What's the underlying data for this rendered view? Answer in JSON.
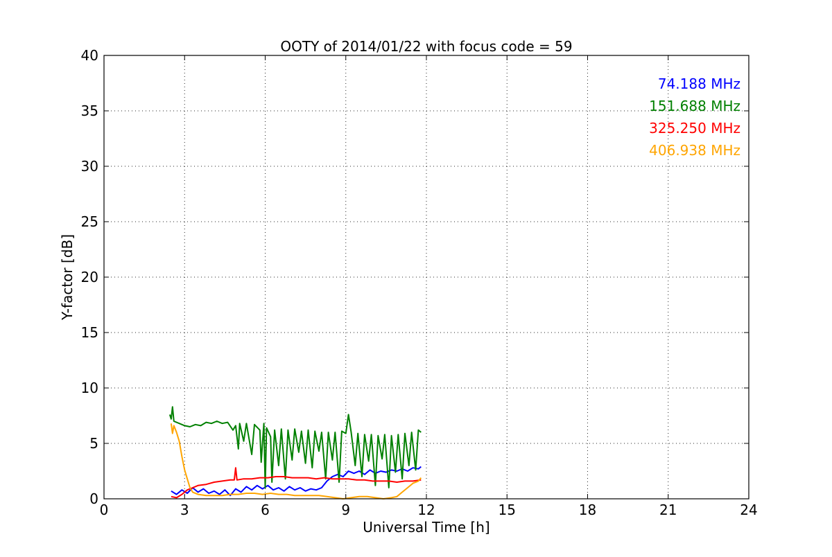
{
  "chart_data": {
    "type": "line",
    "title": "OOTY of 2014/01/22 with focus code = 59",
    "xlabel": "Universal Time [h]",
    "ylabel": "Y-factor [dB]",
    "xlim": [
      0,
      24
    ],
    "ylim": [
      0,
      40
    ],
    "xticks": [
      0,
      3,
      6,
      9,
      12,
      15,
      18,
      21,
      24
    ],
    "yticks": [
      0,
      5,
      10,
      15,
      20,
      25,
      30,
      35,
      40
    ],
    "grid": true,
    "legend_placement": "top-right",
    "series": [
      {
        "name": "74.188 MHz",
        "color": "#0000ff",
        "points": [
          [
            2.5,
            0.7
          ],
          [
            2.7,
            0.4
          ],
          [
            2.9,
            0.8
          ],
          [
            3.1,
            0.5
          ],
          [
            3.3,
            1.0
          ],
          [
            3.5,
            0.6
          ],
          [
            3.7,
            0.9
          ],
          [
            3.9,
            0.5
          ],
          [
            4.1,
            0.7
          ],
          [
            4.3,
            0.4
          ],
          [
            4.5,
            0.8
          ],
          [
            4.7,
            0.3
          ],
          [
            4.9,
            0.9
          ],
          [
            5.1,
            0.6
          ],
          [
            5.3,
            1.1
          ],
          [
            5.5,
            0.8
          ],
          [
            5.7,
            1.2
          ],
          [
            5.9,
            0.9
          ],
          [
            6.1,
            1.2
          ],
          [
            6.3,
            0.8
          ],
          [
            6.5,
            1.0
          ],
          [
            6.7,
            0.7
          ],
          [
            6.9,
            1.1
          ],
          [
            7.1,
            0.8
          ],
          [
            7.3,
            1.0
          ],
          [
            7.5,
            0.7
          ],
          [
            7.7,
            0.9
          ],
          [
            7.9,
            0.8
          ],
          [
            8.1,
            1.0
          ],
          [
            8.3,
            1.6
          ],
          [
            8.5,
            2.0
          ],
          [
            8.7,
            2.2
          ],
          [
            8.9,
            2.0
          ],
          [
            9.1,
            2.5
          ],
          [
            9.3,
            2.3
          ],
          [
            9.5,
            2.5
          ],
          [
            9.7,
            2.2
          ],
          [
            9.9,
            2.6
          ],
          [
            10.1,
            2.3
          ],
          [
            10.3,
            2.5
          ],
          [
            10.5,
            2.4
          ],
          [
            10.7,
            2.6
          ],
          [
            10.9,
            2.5
          ],
          [
            11.1,
            2.7
          ],
          [
            11.3,
            2.5
          ],
          [
            11.5,
            2.8
          ],
          [
            11.7,
            2.7
          ],
          [
            11.8,
            2.9
          ]
        ]
      },
      {
        "name": "151.688 MHz",
        "color": "#008000",
        "points": [
          [
            2.45,
            7.6
          ],
          [
            2.5,
            7.2
          ],
          [
            2.55,
            8.3
          ],
          [
            2.6,
            7.0
          ],
          [
            2.8,
            6.8
          ],
          [
            3.0,
            6.6
          ],
          [
            3.2,
            6.5
          ],
          [
            3.4,
            6.7
          ],
          [
            3.6,
            6.6
          ],
          [
            3.8,
            6.9
          ],
          [
            4.0,
            6.8
          ],
          [
            4.2,
            7.0
          ],
          [
            4.4,
            6.8
          ],
          [
            4.6,
            6.9
          ],
          [
            4.8,
            6.2
          ],
          [
            4.9,
            6.6
          ],
          [
            5.0,
            4.5
          ],
          [
            5.05,
            6.8
          ],
          [
            5.2,
            5.2
          ],
          [
            5.3,
            6.8
          ],
          [
            5.5,
            4.0
          ],
          [
            5.6,
            6.7
          ],
          [
            5.8,
            6.2
          ],
          [
            5.85,
            3.3
          ],
          [
            5.95,
            6.8
          ],
          [
            6.0,
            1.0
          ],
          [
            6.05,
            6.4
          ],
          [
            6.2,
            5.6
          ],
          [
            6.25,
            1.5
          ],
          [
            6.35,
            6.2
          ],
          [
            6.5,
            3.0
          ],
          [
            6.6,
            6.3
          ],
          [
            6.75,
            1.8
          ],
          [
            6.85,
            6.2
          ],
          [
            7.0,
            3.5
          ],
          [
            7.1,
            6.3
          ],
          [
            7.25,
            4.2
          ],
          [
            7.35,
            6.1
          ],
          [
            7.5,
            3.2
          ],
          [
            7.6,
            6.2
          ],
          [
            7.75,
            2.8
          ],
          [
            7.85,
            6.1
          ],
          [
            8.0,
            4.3
          ],
          [
            8.1,
            6.0
          ],
          [
            8.25,
            1.8
          ],
          [
            8.35,
            6.0
          ],
          [
            8.5,
            3.5
          ],
          [
            8.6,
            6.0
          ],
          [
            8.75,
            1.5
          ],
          [
            8.85,
            6.1
          ],
          [
            9.0,
            5.9
          ],
          [
            9.1,
            7.6
          ],
          [
            9.2,
            6.0
          ],
          [
            9.35,
            3.0
          ],
          [
            9.45,
            5.9
          ],
          [
            9.6,
            2.0
          ],
          [
            9.7,
            5.8
          ],
          [
            9.85,
            3.4
          ],
          [
            9.95,
            5.8
          ],
          [
            10.1,
            1.2
          ],
          [
            10.2,
            5.7
          ],
          [
            10.35,
            3.6
          ],
          [
            10.45,
            5.8
          ],
          [
            10.6,
            1.0
          ],
          [
            10.7,
            5.7
          ],
          [
            10.85,
            2.4
          ],
          [
            10.95,
            5.8
          ],
          [
            11.1,
            1.8
          ],
          [
            11.2,
            5.9
          ],
          [
            11.35,
            3.0
          ],
          [
            11.45,
            6.0
          ],
          [
            11.6,
            2.6
          ],
          [
            11.7,
            6.2
          ],
          [
            11.8,
            6.0
          ]
        ]
      },
      {
        "name": "325.250 MHz",
        "color": "#ff0000",
        "points": [
          [
            2.5,
            0.2
          ],
          [
            2.7,
            0.1
          ],
          [
            2.9,
            0.4
          ],
          [
            3.1,
            0.8
          ],
          [
            3.3,
            1.0
          ],
          [
            3.5,
            1.2
          ],
          [
            3.8,
            1.3
          ],
          [
            4.1,
            1.5
          ],
          [
            4.4,
            1.6
          ],
          [
            4.7,
            1.7
          ],
          [
            4.85,
            1.7
          ],
          [
            4.9,
            2.8
          ],
          [
            4.95,
            1.7
          ],
          [
            5.2,
            1.8
          ],
          [
            5.5,
            1.8
          ],
          [
            5.8,
            1.9
          ],
          [
            6.1,
            1.9
          ],
          [
            6.4,
            2.0
          ],
          [
            6.7,
            2.0
          ],
          [
            7.0,
            1.9
          ],
          [
            7.3,
            1.9
          ],
          [
            7.6,
            1.9
          ],
          [
            7.9,
            1.8
          ],
          [
            8.2,
            1.9
          ],
          [
            8.5,
            1.8
          ],
          [
            8.8,
            1.8
          ],
          [
            9.1,
            1.8
          ],
          [
            9.4,
            1.7
          ],
          [
            9.7,
            1.7
          ],
          [
            10.0,
            1.6
          ],
          [
            10.3,
            1.6
          ],
          [
            10.6,
            1.6
          ],
          [
            10.9,
            1.5
          ],
          [
            11.2,
            1.6
          ],
          [
            11.5,
            1.6
          ],
          [
            11.8,
            1.7
          ]
        ]
      },
      {
        "name": "406.938 MHz",
        "color": "#ffa500",
        "points": [
          [
            2.5,
            6.8
          ],
          [
            2.55,
            5.9
          ],
          [
            2.6,
            6.6
          ],
          [
            2.7,
            6.0
          ],
          [
            2.8,
            5.2
          ],
          [
            2.9,
            3.8
          ],
          [
            3.0,
            2.6
          ],
          [
            3.1,
            1.8
          ],
          [
            3.2,
            1.0
          ],
          [
            3.3,
            0.6
          ],
          [
            3.5,
            0.4
          ],
          [
            3.8,
            0.3
          ],
          [
            4.1,
            0.3
          ],
          [
            4.4,
            0.3
          ],
          [
            4.7,
            0.4
          ],
          [
            5.0,
            0.4
          ],
          [
            5.3,
            0.5
          ],
          [
            5.6,
            0.5
          ],
          [
            5.9,
            0.4
          ],
          [
            6.2,
            0.5
          ],
          [
            6.5,
            0.4
          ],
          [
            6.8,
            0.4
          ],
          [
            7.1,
            0.3
          ],
          [
            7.4,
            0.3
          ],
          [
            7.7,
            0.3
          ],
          [
            8.0,
            0.3
          ],
          [
            8.3,
            0.2
          ],
          [
            8.6,
            0.1
          ],
          [
            8.9,
            0.0
          ],
          [
            9.2,
            0.1
          ],
          [
            9.5,
            0.2
          ],
          [
            9.8,
            0.2
          ],
          [
            10.1,
            0.1
          ],
          [
            10.4,
            0.0
          ],
          [
            10.7,
            0.1
          ],
          [
            10.9,
            0.2
          ],
          [
            11.1,
            0.6
          ],
          [
            11.3,
            1.0
          ],
          [
            11.5,
            1.4
          ],
          [
            11.7,
            1.6
          ],
          [
            11.8,
            1.9
          ]
        ]
      }
    ]
  }
}
